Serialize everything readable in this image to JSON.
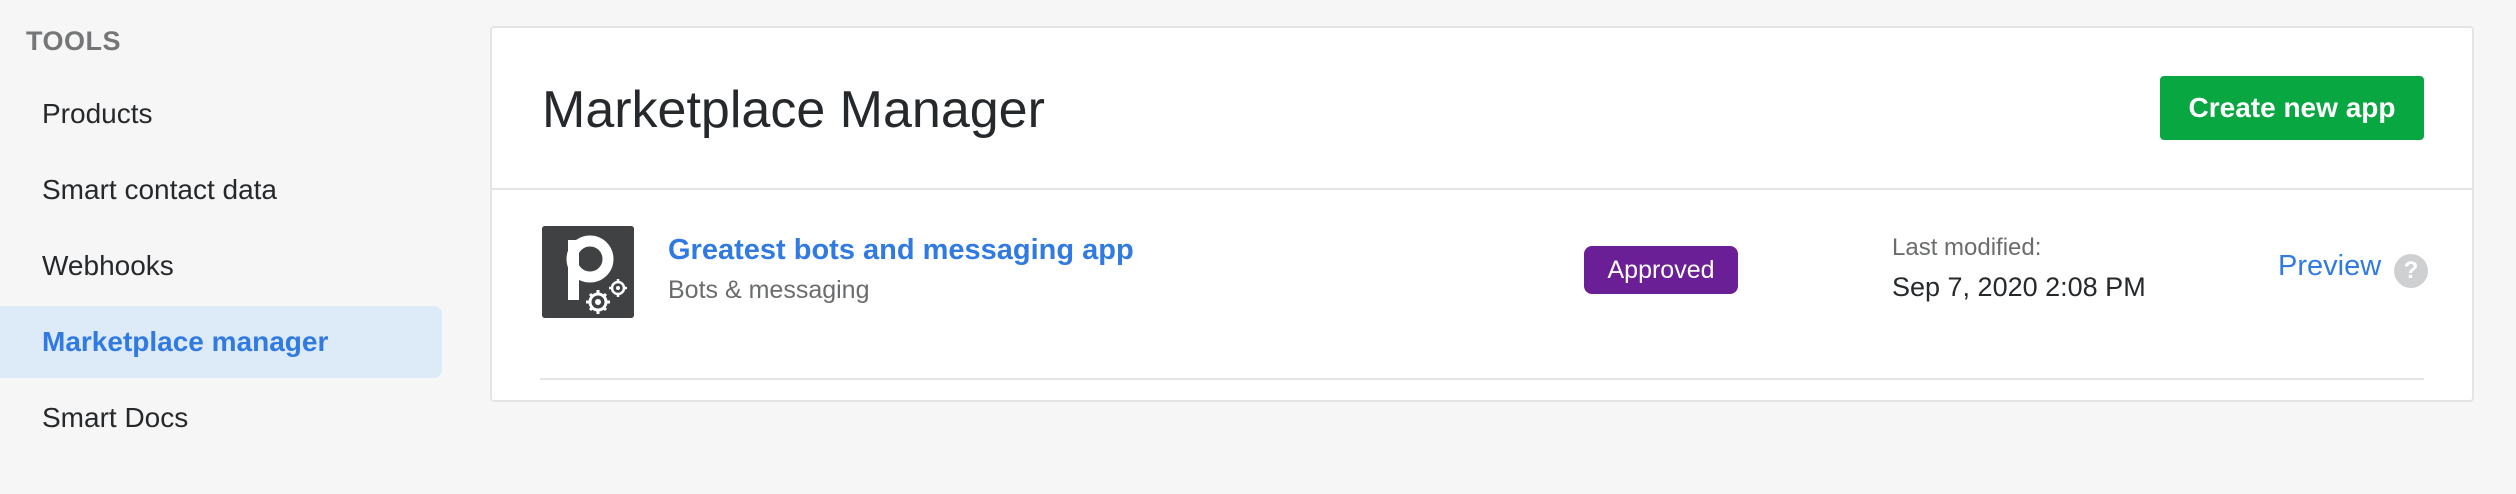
{
  "sidebar": {
    "heading": "TOOLS",
    "items": [
      {
        "label": "Products"
      },
      {
        "label": "Smart contact data"
      },
      {
        "label": "Webhooks"
      },
      {
        "label": "Marketplace manager",
        "active": true
      },
      {
        "label": "Smart Docs"
      }
    ]
  },
  "main": {
    "title": "Marketplace Manager",
    "create_button_label": "Create new app",
    "apps": [
      {
        "logo_icon": "pipedrive-bot-gear-icon",
        "name": "Greatest bots and messaging app",
        "category": "Bots & messaging",
        "status": "Approved",
        "modified_label": "Last modified:",
        "modified_value": "Sep 7, 2020 2:08 PM",
        "preview_label": "Preview",
        "help_icon": "question-icon",
        "help_glyph": "?"
      }
    ]
  },
  "colors": {
    "accent_blue": "#317ae2",
    "create_green": "#08a742",
    "approved_purple": "#6b1f96",
    "active_bg": "#ddeaf8"
  }
}
